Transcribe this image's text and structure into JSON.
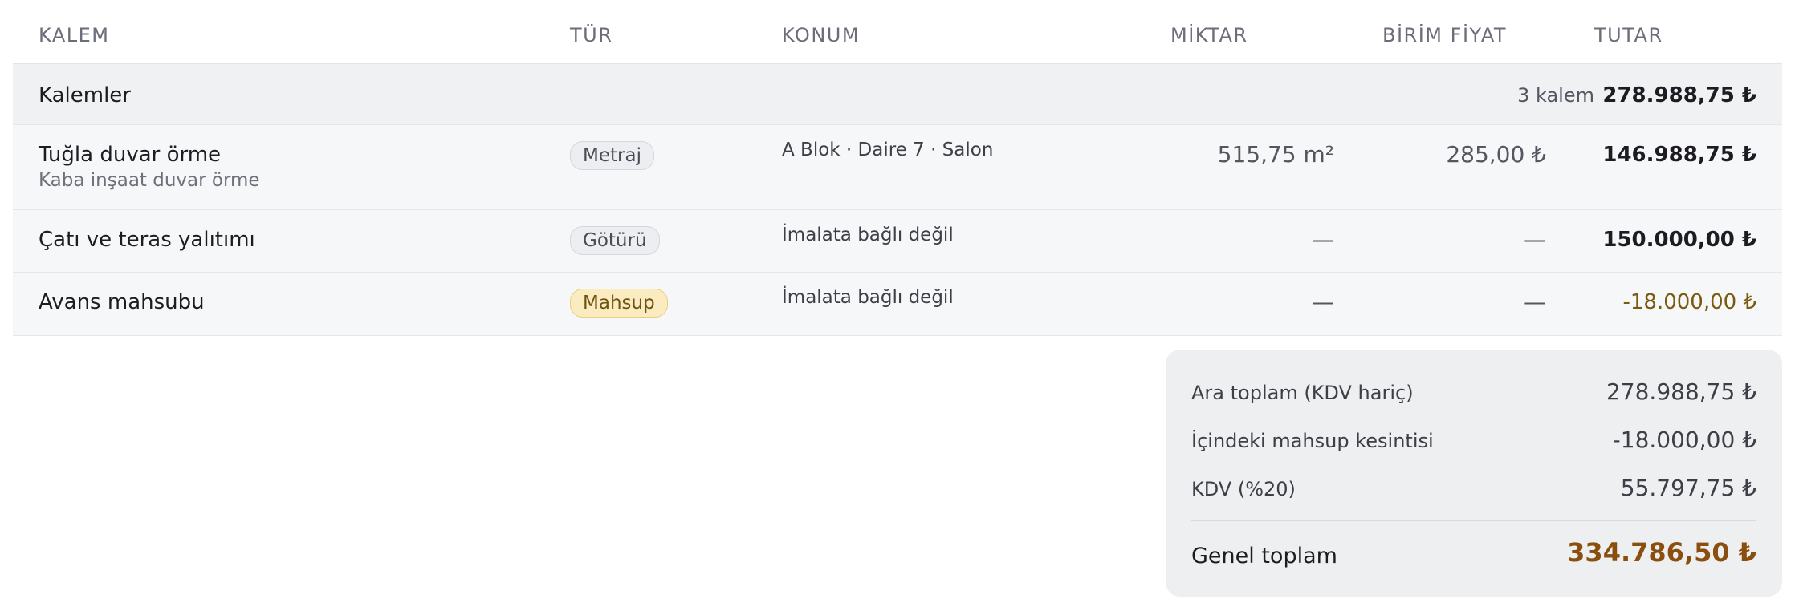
{
  "columns": {
    "kalem": "KALEM",
    "tur": "TÜR",
    "konum": "KONUM",
    "miktar": "MİKTAR",
    "birim_fiyat": "BİRİM FİYAT",
    "tutar": "TUTAR"
  },
  "group": {
    "title": "Kalemler",
    "count": "3 kalem",
    "total": "278.988,75 ₺"
  },
  "rows": [
    {
      "name": "Tuğla duvar örme",
      "subtitle": "Kaba inşaat duvar örme",
      "type": "Metraj",
      "location": "A Blok · Daire 7 · Salon",
      "quantity": "515,75 m²",
      "unit_price": "285,00 ₺",
      "amount": "146.988,75 ₺"
    },
    {
      "name": "Çatı ve teras yalıtımı",
      "type": "Götürü",
      "location": "İmalata bağlı değil",
      "quantity": "—",
      "unit_price": "—",
      "amount": "150.000,00 ₺"
    },
    {
      "name": "Avans mahsubu",
      "type": "Mahsup",
      "location": "İmalata bağlı değil",
      "quantity": "—",
      "unit_price": "—",
      "amount": "-18.000,00 ₺"
    }
  ],
  "summary": {
    "subtotal_label": "Ara toplam (KDV hariç)",
    "subtotal_value": "278.988,75 ₺",
    "deduction_label": "İçindeki mahsup kesintisi",
    "deduction_value": "-18.000,00 ₺",
    "vat_label": "KDV (%20)",
    "vat_value": "55.797,75 ₺",
    "grand_label": "Genel toplam",
    "grand_value": "334.786,50 ₺"
  },
  "colors": {
    "mahsup_badge": "#faecc0",
    "negative_amount": "#7a5a0f",
    "grand_total": "#8a4f0e"
  }
}
